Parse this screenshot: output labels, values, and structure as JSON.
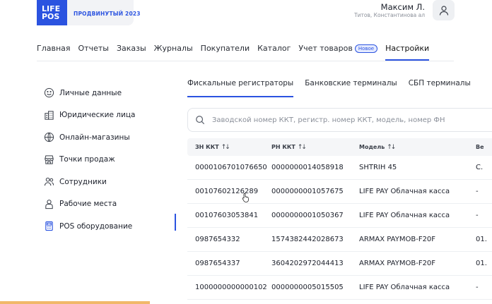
{
  "logo": {
    "line1": "LIFE",
    "line2": "POS",
    "caption": "ПРОДВИНУТЫЙ 2023"
  },
  "user": {
    "name": "Максим Л.",
    "org": "Титов, Константинова ал"
  },
  "nav": {
    "items": [
      {
        "label": "Главная",
        "active": false
      },
      {
        "label": "Отчеты",
        "active": false
      },
      {
        "label": "Заказы",
        "active": false
      },
      {
        "label": "Журналы",
        "active": false
      },
      {
        "label": "Покупатели",
        "active": false
      },
      {
        "label": "Каталог",
        "active": false
      },
      {
        "label": "Учет товаров",
        "badge": "Новое",
        "active": false
      },
      {
        "label": "Настройки",
        "active": true
      }
    ]
  },
  "sidebar": {
    "items": [
      {
        "label": "Личные данные",
        "icon": "smile-icon"
      },
      {
        "label": "Юридические лица",
        "icon": "building-icon"
      },
      {
        "label": "Онлайн-магазины",
        "icon": "globe-icon"
      },
      {
        "label": "Точки продаж",
        "icon": "store-icon"
      },
      {
        "label": "Сотрудники",
        "icon": "users-icon"
      },
      {
        "label": "Рабочие места",
        "icon": "workplace-icon"
      },
      {
        "label": "POS оборудование",
        "icon": "pos-icon",
        "active": true
      }
    ]
  },
  "tabs": [
    {
      "label": "Фискальные регистраторы",
      "active": true
    },
    {
      "label": "Банковские терминалы",
      "active": false
    },
    {
      "label": "СБП терминалы",
      "active": false
    }
  ],
  "search": {
    "placeholder": "Заводской номер ККТ, регистр. номер ККТ, модель, номер ФН"
  },
  "table": {
    "headers": [
      "ЗН ККТ",
      "РН ККТ",
      "Модель",
      "Ве"
    ],
    "rows": [
      [
        "0000106701076650",
        "0000000014058918",
        "SHTRIH 45",
        "С."
      ],
      [
        "00107602126289",
        "0000000001057675",
        "LIFE PAY Облачная касса",
        "-"
      ],
      [
        "00107603053841",
        "0000000001050367",
        "LIFE PAY Облачная касса",
        "-"
      ],
      [
        "0987654332",
        "1574382442028673",
        "ARMAX PAYMOB-F20F",
        "01."
      ],
      [
        "0987654337",
        "3604202972044413",
        "ARMAX PAYMOB-F20F",
        "01."
      ],
      [
        "1000000000000102",
        "0000000005015505",
        "LIFE PAY Облачная касса",
        "-"
      ]
    ]
  },
  "colors": {
    "accent": "#2b53e0",
    "text": "#1b1f2a",
    "muted": "#8a8f99"
  }
}
